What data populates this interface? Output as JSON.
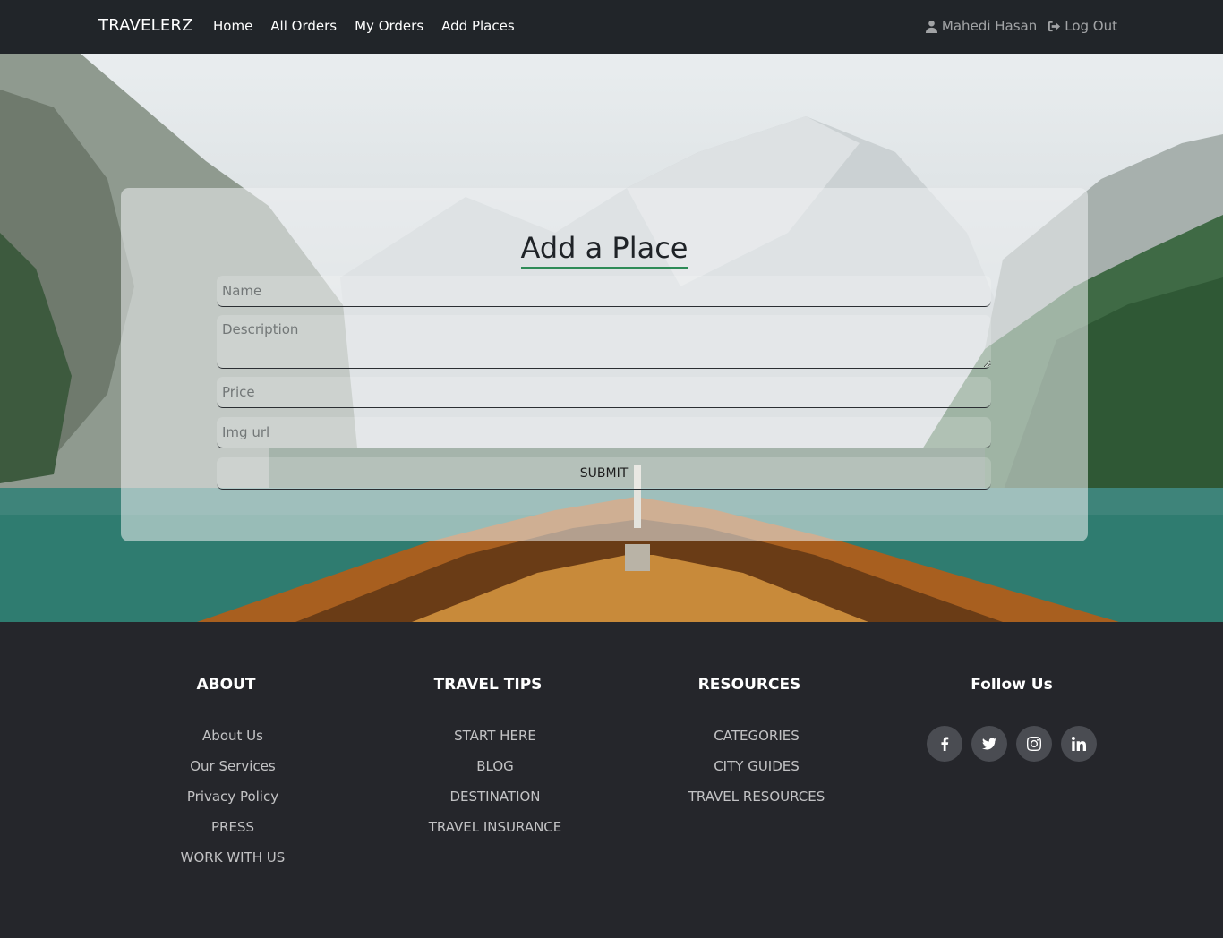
{
  "navbar": {
    "brand": "TRAVELERZ",
    "links": [
      "Home",
      "All Orders",
      "My Orders",
      "Add Places"
    ],
    "user_name": "Mahedi Hasan",
    "logout": "Log Out"
  },
  "form": {
    "title": "Add a Place",
    "name_placeholder": "Name",
    "description_placeholder": "Description",
    "price_placeholder": "Price",
    "img_placeholder": "Img url",
    "submit_label": "SUBMIT"
  },
  "footer": {
    "about": {
      "title": "ABOUT",
      "items": [
        "About Us",
        "Our Services",
        "Privacy Policy",
        "PRESS",
        "WORK WITH US"
      ]
    },
    "tips": {
      "title": "TRAVEL TIPS",
      "items": [
        "START HERE",
        "BLOG",
        "DESTINATION",
        "TRAVEL INSURANCE"
      ]
    },
    "resources": {
      "title": "RESOURCES",
      "items": [
        "CATEGORIES",
        "CITY GUIDES",
        "TRAVEL RESOURCES"
      ]
    },
    "follow": {
      "title": "Follow Us",
      "icons": [
        "facebook-icon",
        "twitter-icon",
        "instagram-icon",
        "linkedin-icon"
      ]
    }
  },
  "colors": {
    "navbar_bg": "#212529",
    "footer_bg": "#25262b",
    "accent": "#2e8b57"
  }
}
